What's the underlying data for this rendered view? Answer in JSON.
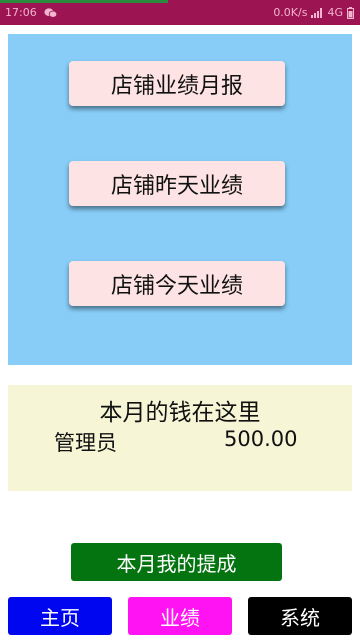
{
  "status_bar": {
    "time": "17:06",
    "network_speed": "0.0K/s",
    "network_type": "4G",
    "icons": [
      "wechat-icon",
      "signal-icon",
      "battery-icon"
    ]
  },
  "report_buttons": [
    {
      "label": "店铺业绩月报"
    },
    {
      "label": "店铺昨天业绩"
    },
    {
      "label": "店铺今天业绩"
    }
  ],
  "earnings": {
    "title": "本月的钱在这里",
    "name": "管理员",
    "amount": "500.00"
  },
  "commission_button": {
    "label": "本月我的提成"
  },
  "tabs": [
    {
      "label": "主页"
    },
    {
      "label": "业绩"
    },
    {
      "label": "系统"
    }
  ],
  "colors": {
    "status_bar": "#9c1452",
    "report_panel": "#87cdf7",
    "report_button": "#fde3e3",
    "earnings_panel": "#f6f6d6",
    "commission_button": "#047410",
    "tab_home": "#0007f0",
    "tab_performance": "#ff13f2",
    "tab_system": "#000000"
  }
}
